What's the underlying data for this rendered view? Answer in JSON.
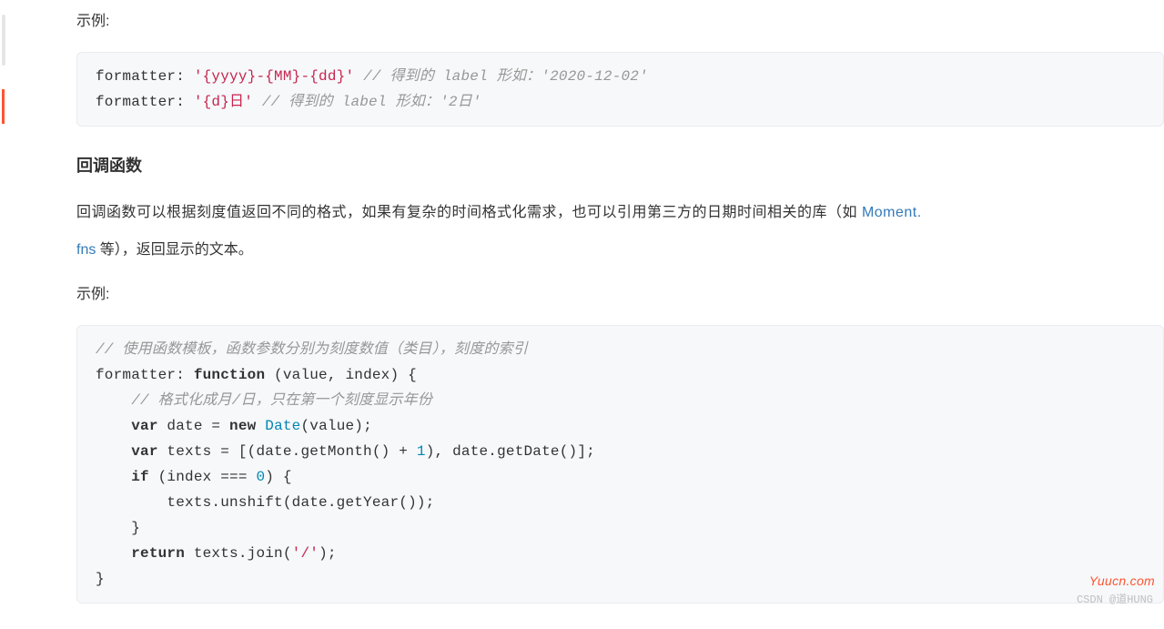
{
  "labels": {
    "example1": "示例:",
    "example2": "示例:",
    "section": "回调函数",
    "para_prefix": "回调函数可以根据刻度值返回不同的格式，如果有复杂的时间格式化需求，也可以引用第三方的日期时间相关的库（如 ",
    "link1": "Moment.",
    "link2": "fns",
    "para_suffix": " 等），返回显示的文本。"
  },
  "code1": {
    "a_key": "formatter: ",
    "a_str": "'{yyyy}-{MM}-{dd}'",
    "a_com": " // 得到的 label 形如：'2020-12-02'",
    "b_key": "formatter: ",
    "b_str": "'{d}日'",
    "b_com": " // 得到的 label 形如：'2日'"
  },
  "code2": {
    "l1": "// 使用函数模板，函数参数分别为刻度数值（类目），刻度的索引",
    "l2_a": "formatter: ",
    "l2_b": "function",
    "l2_c": " (value, index) {",
    "l3": "    // 格式化成月/日，只在第一个刻度显示年份",
    "l4_a": "    ",
    "l4_b": "var",
    "l4_c": " date = ",
    "l4_d": "new",
    "l4_e": " ",
    "l4_f": "Date",
    "l4_g": "(value);",
    "l5_a": "    ",
    "l5_b": "var",
    "l5_c": " texts = [(date.getMonth() + ",
    "l5_d": "1",
    "l5_e": "), date.getDate()];",
    "l6_a": "    ",
    "l6_b": "if",
    "l6_c": " (index === ",
    "l6_d": "0",
    "l6_e": ") {",
    "l7": "        texts.unshift(date.getYear());",
    "l8": "    }",
    "l9_a": "    ",
    "l9_b": "return",
    "l9_c": " texts.join(",
    "l9_d": "'/'",
    "l9_e": ");",
    "l10": "}"
  },
  "watermark": {
    "red": "Yuucn.com",
    "grey": "CSDN @道HUNG"
  }
}
